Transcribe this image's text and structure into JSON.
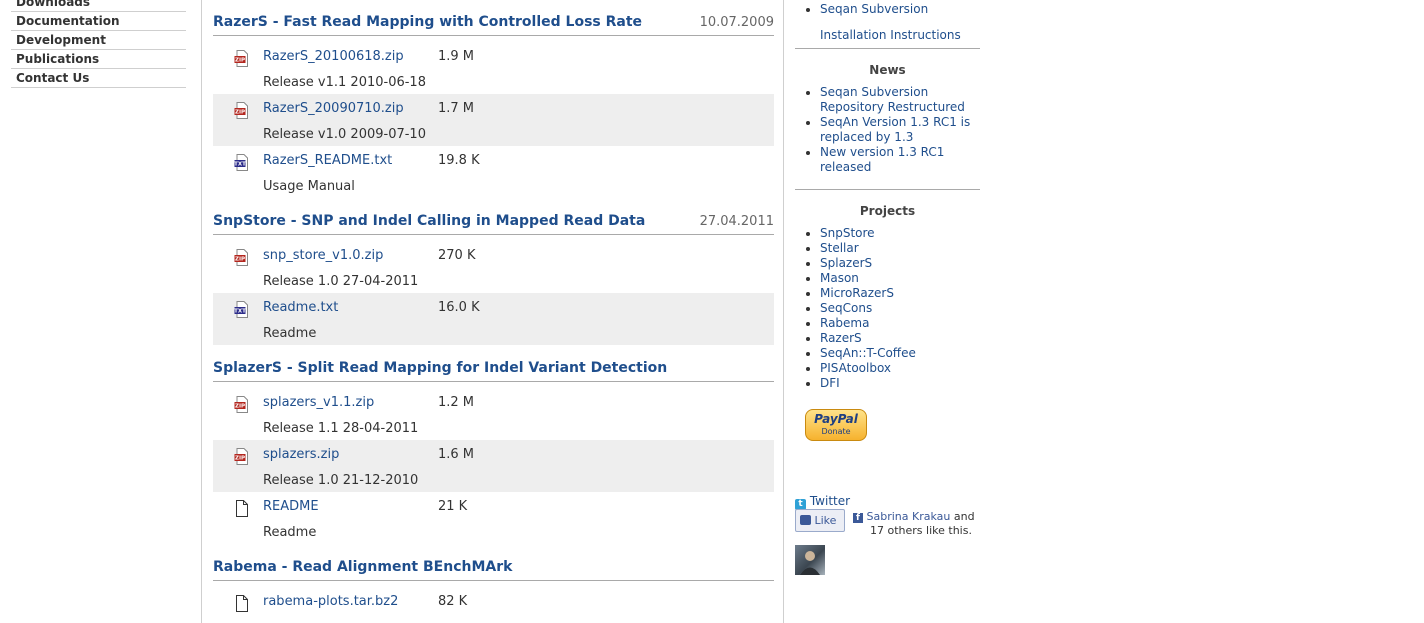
{
  "left_nav": {
    "items": [
      "Downloads",
      "Documentation",
      "Development",
      "Publications",
      "Contact Us"
    ]
  },
  "sections": [
    {
      "title": "RazerS - Fast Read Mapping with Controlled Loss Rate",
      "date": "10.07.2009",
      "files": [
        {
          "icon": "zip-file-icon",
          "name": "RazerS_20100618.zip",
          "size": "1.9 M",
          "desc": "Release v1.1 2010-06-18"
        },
        {
          "icon": "zip-file-icon",
          "name": "RazerS_20090710.zip",
          "size": "1.7 M",
          "desc": "Release v1.0 2009-07-10"
        },
        {
          "icon": "txt-file-icon",
          "name": "RazerS_README.txt",
          "size": "19.8 K",
          "desc": "Usage Manual"
        }
      ]
    },
    {
      "title": "SnpStore - SNP and Indel Calling in Mapped Read Data",
      "date": "27.04.2011",
      "files": [
        {
          "icon": "zip-file-icon",
          "name": "snp_store_v1.0.zip",
          "size": "270 K",
          "desc": "Release 1.0 27-04-2011"
        },
        {
          "icon": "txt-file-icon",
          "name": "Readme.txt",
          "size": "16.0 K",
          "desc": "Readme"
        }
      ]
    },
    {
      "title": "SplazerS - Split Read Mapping for Indel Variant Detection",
      "date": "",
      "files": [
        {
          "icon": "zip-file-icon",
          "name": "splazers_v1.1.zip",
          "size": "1.2 M",
          "desc": "Release 1.1 28-04-2011"
        },
        {
          "icon": "zip-file-icon",
          "name": "splazers.zip",
          "size": "1.6 M",
          "desc": "Release 1.0 21-12-2010"
        },
        {
          "icon": "blank-file-icon",
          "name": "README",
          "size": "21 K",
          "desc": "Readme"
        }
      ]
    },
    {
      "title": "Rabema - Read Alignment BEnchMArk",
      "date": "",
      "files": [
        {
          "icon": "blank-file-icon",
          "name": "rabema-plots.tar.bz2",
          "size": "82 K",
          "desc": ""
        }
      ]
    }
  ],
  "sidebar": {
    "top_links": [
      "Seqan Subversion"
    ],
    "installation_link": "Installation Instructions",
    "news_heading": "News",
    "news_items": [
      "Seqan Subversion Repository Restructured",
      "SeqAn Version 1.3 RC1 is replaced by 1.3",
      "New version 1.3 RC1 released"
    ],
    "projects_heading": "Projects",
    "projects": [
      "SnpStore",
      "Stellar",
      "SplazerS",
      "Mason",
      "MicroRazerS",
      "SeqCons",
      "Rabema",
      "RazerS",
      "SeqAn::T-Coffee",
      "PISAtoolbox",
      "DFI"
    ],
    "paypal": {
      "brand": "PayPal",
      "label": "Donate"
    },
    "twitter_label": "Twitter",
    "like_button": "Like",
    "like_person": "Sabrina Krakau",
    "like_suffix": " and",
    "like_others": "17 others like this.",
    "colors": {
      "link": "#1f4e8c",
      "shade": "#eeeeee",
      "facebook": "#3b5998",
      "twitter": "#2fa1d6",
      "paypal": "#f6b22e"
    }
  }
}
